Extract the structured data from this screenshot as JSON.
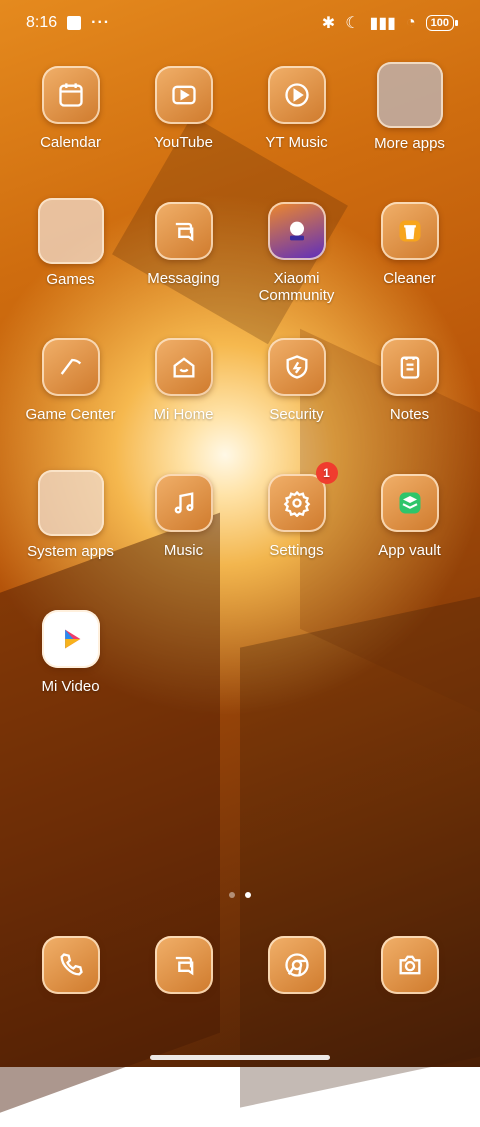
{
  "status": {
    "time": "8:16",
    "battery": "100"
  },
  "apps": [
    {
      "label": "Calendar"
    },
    {
      "label": "YouTube"
    },
    {
      "label": "YT Music"
    },
    {
      "label": "More apps"
    },
    {
      "label": "Games"
    },
    {
      "label": "Messaging"
    },
    {
      "label": "Xiaomi Community"
    },
    {
      "label": "Cleaner"
    },
    {
      "label": "Game Center"
    },
    {
      "label": "Mi Home"
    },
    {
      "label": "Security"
    },
    {
      "label": "Notes"
    },
    {
      "label": "System apps"
    },
    {
      "label": "Music"
    },
    {
      "label": "Settings",
      "badge": "1"
    },
    {
      "label": "App vault"
    },
    {
      "label": "Mi Video"
    }
  ],
  "dock": [
    {
      "icon": "phone-icon"
    },
    {
      "icon": "messaging-icon"
    },
    {
      "icon": "chrome-icon"
    },
    {
      "icon": "camera-icon"
    }
  ],
  "pager": {
    "pages": 2,
    "active": 2
  }
}
